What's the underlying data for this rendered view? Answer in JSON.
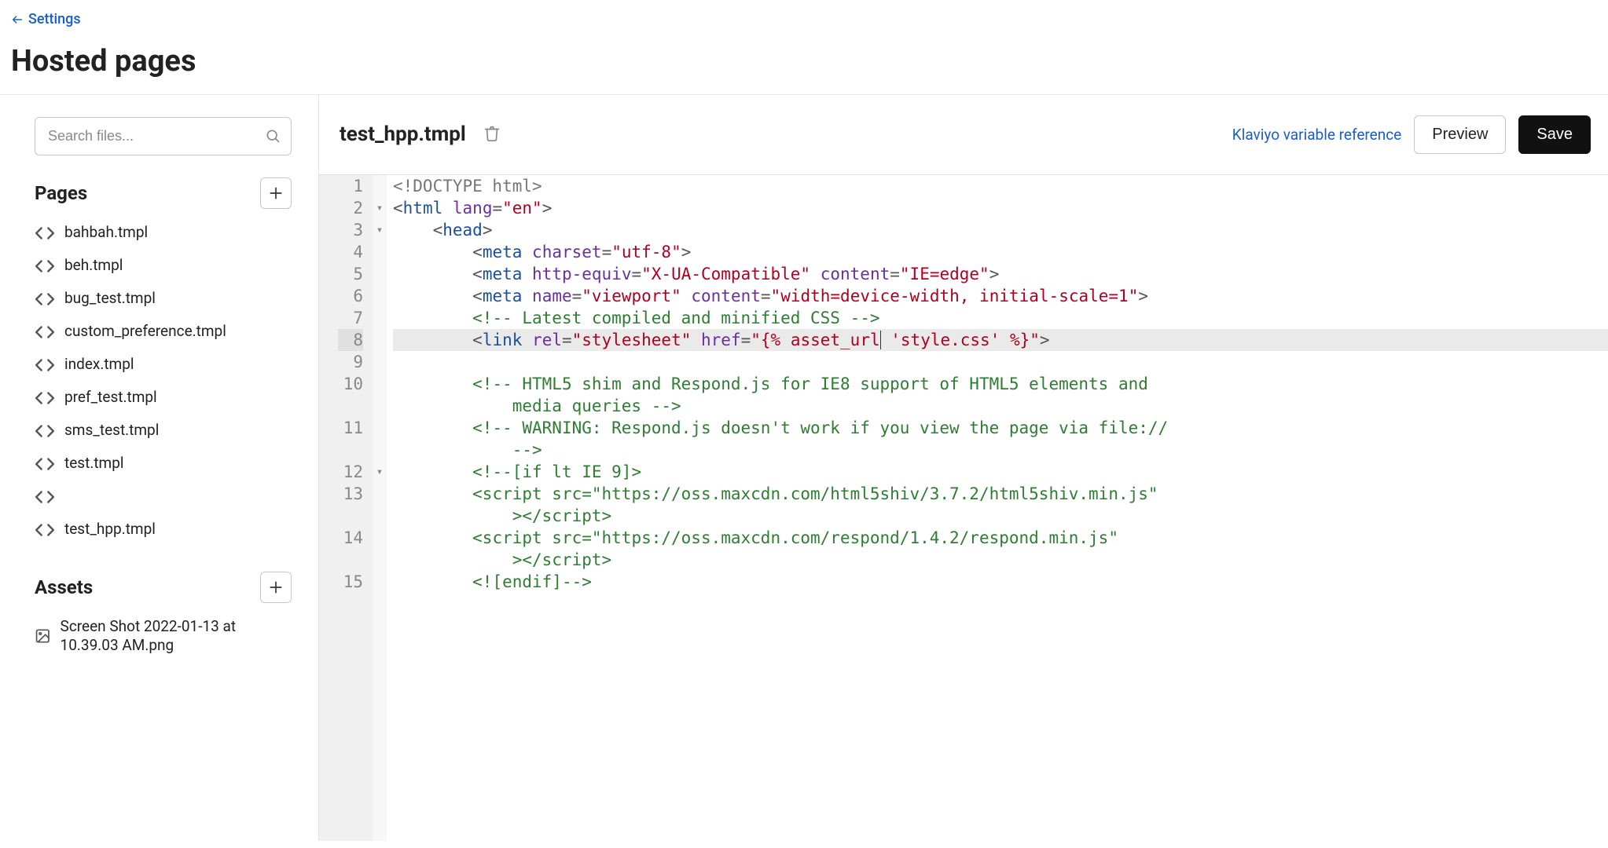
{
  "header": {
    "back_label": "Settings",
    "title": "Hosted pages"
  },
  "sidebar": {
    "search_placeholder": "Search files...",
    "pages_heading": "Pages",
    "assets_heading": "Assets",
    "pages": [
      "bahbah.tmpl",
      "beh.tmpl",
      "bug_test.tmpl",
      "custom_preference.tmpl",
      "index.tmpl",
      "pref_test.tmpl",
      "sms_test.tmpl",
      "test.tmpl",
      "",
      "test_hpp.tmpl"
    ],
    "assets": [
      "Screen Shot 2022-01-13 at 10.39.03 AM.png"
    ]
  },
  "editor": {
    "filename": "test_hpp.tmpl",
    "var_ref_label": "Klaviyo variable reference",
    "preview_label": "Preview",
    "save_label": "Save",
    "highlighted_line": 8,
    "fold_markers": {
      "2": "▾",
      "3": "▾",
      "12": "▾"
    },
    "line_numbers": [
      "1",
      "2",
      "3",
      "4",
      "5",
      "6",
      "7",
      "8",
      "9",
      "10",
      "",
      "11",
      "",
      "12",
      "13",
      "",
      "14",
      "",
      "15"
    ],
    "lines_html": [
      "<span class='tok-doctype'>&lt;!DOCTYPE html&gt;</span>",
      "<span class='tok-punct'>&lt;</span><span class='tok-tag'>html</span> <span class='tok-attr'>lang</span><span class='tok-punct'>=</span><span class='tok-string'>\"en\"</span><span class='tok-punct'>&gt;</span>",
      "    <span class='tok-punct'>&lt;</span><span class='tok-tag'>head</span><span class='tok-punct'>&gt;</span>",
      "        <span class='tok-punct'>&lt;</span><span class='tok-tag'>meta</span> <span class='tok-attr'>charset</span><span class='tok-punct'>=</span><span class='tok-string'>\"utf-8\"</span><span class='tok-punct'>&gt;</span>",
      "        <span class='tok-punct'>&lt;</span><span class='tok-tag'>meta</span> <span class='tok-attr'>http-equiv</span><span class='tok-punct'>=</span><span class='tok-string'>\"X-UA-Compatible\"</span> <span class='tok-attr'>content</span><span class='tok-punct'>=</span><span class='tok-string'>\"IE=edge\"</span><span class='tok-punct'>&gt;</span>",
      "        <span class='tok-punct'>&lt;</span><span class='tok-tag'>meta</span> <span class='tok-attr'>name</span><span class='tok-punct'>=</span><span class='tok-string'>\"viewport\"</span> <span class='tok-attr'>content</span><span class='tok-punct'>=</span><span class='tok-string'>\"width=device-width, initial-scale=1\"</span><span class='tok-punct'>&gt;</span>",
      "        <span class='tok-comment'>&lt;!-- Latest compiled and minified CSS --&gt;</span>",
      "        <span class='tok-punct'>&lt;</span><span class='tok-tag'>link</span> <span class='tok-attr'>rel</span><span class='tok-punct'>=</span><span class='tok-string'>\"stylesheet\"</span> <span class='tok-attr'>href</span><span class='tok-punct'>=</span><span class='tok-string'>\"{% asset_url<span style='border-left:1px solid #333'></span> 'style.css' %}\"</span><span class='tok-punct'>&gt;</span>",
      "",
      "        <span class='tok-comment'>&lt;!-- HTML5 shim and Respond.js for IE8 support of HTML5 elements and</span>",
      "<span class='tok-comment'>            media queries --&gt;</span>",
      "        <span class='tok-comment'>&lt;!-- WARNING: Respond.js doesn't work if you view the page via file://</span>",
      "<span class='tok-comment'>            --&gt;</span>",
      "        <span class='tok-comment'>&lt;!--[if lt IE 9]&gt;</span>",
      "        <span class='tok-comment'>&lt;script src=\"https://oss.maxcdn.com/html5shiv/3.7.2/html5shiv.min.js\"</span>",
      "<span class='tok-comment'>            &gt;&lt;/script&gt;</span>",
      "        <span class='tok-comment'>&lt;script src=\"https://oss.maxcdn.com/respond/1.4.2/respond.min.js\"</span>",
      "<span class='tok-comment'>            &gt;&lt;/script&gt;</span>",
      "        <span class='tok-comment'>&lt;![endif]--&gt;</span>"
    ]
  }
}
